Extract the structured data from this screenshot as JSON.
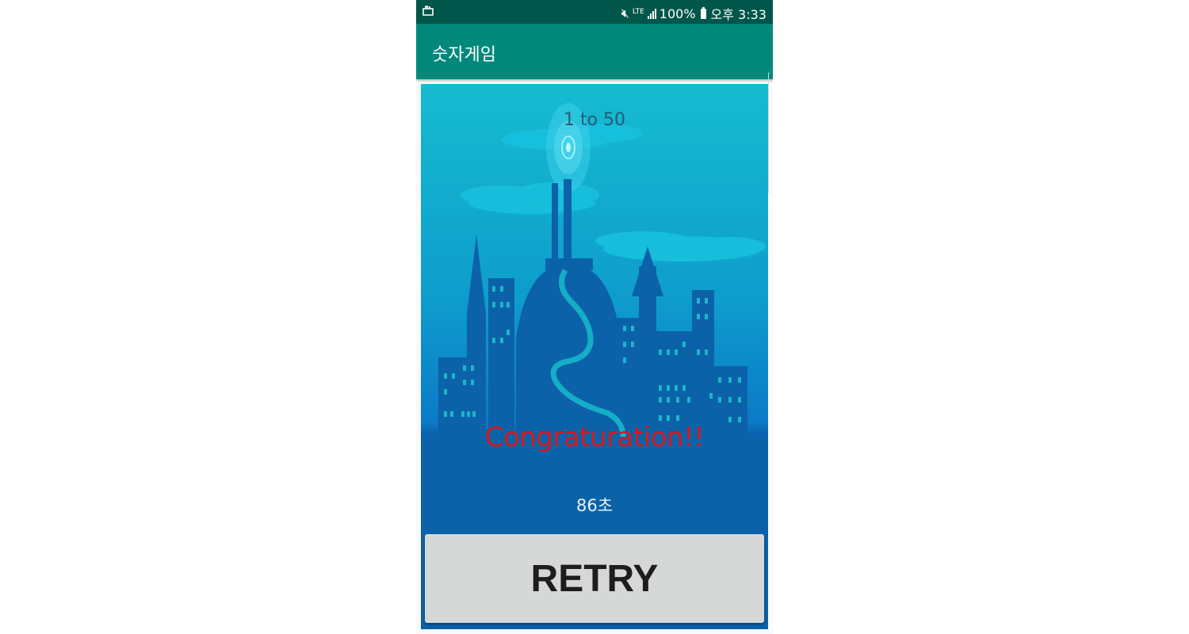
{
  "status_bar": {
    "icons": [
      "screenshot-icon",
      "mute-icon",
      "lte-icon",
      "signal-icon",
      "battery-icon"
    ],
    "lte": "LTE",
    "battery": "100%",
    "time": "오후 3:33"
  },
  "app_bar": {
    "title": "숫자게임"
  },
  "game": {
    "title": "1 to 50",
    "result": "Congraturation!!",
    "time": "86초",
    "retry_label": "RETRY"
  },
  "colors": {
    "status_bar": "#00564a",
    "app_bar": "#00897b",
    "result_text": "#d8191e",
    "retry_button": "#d6d8d8"
  }
}
